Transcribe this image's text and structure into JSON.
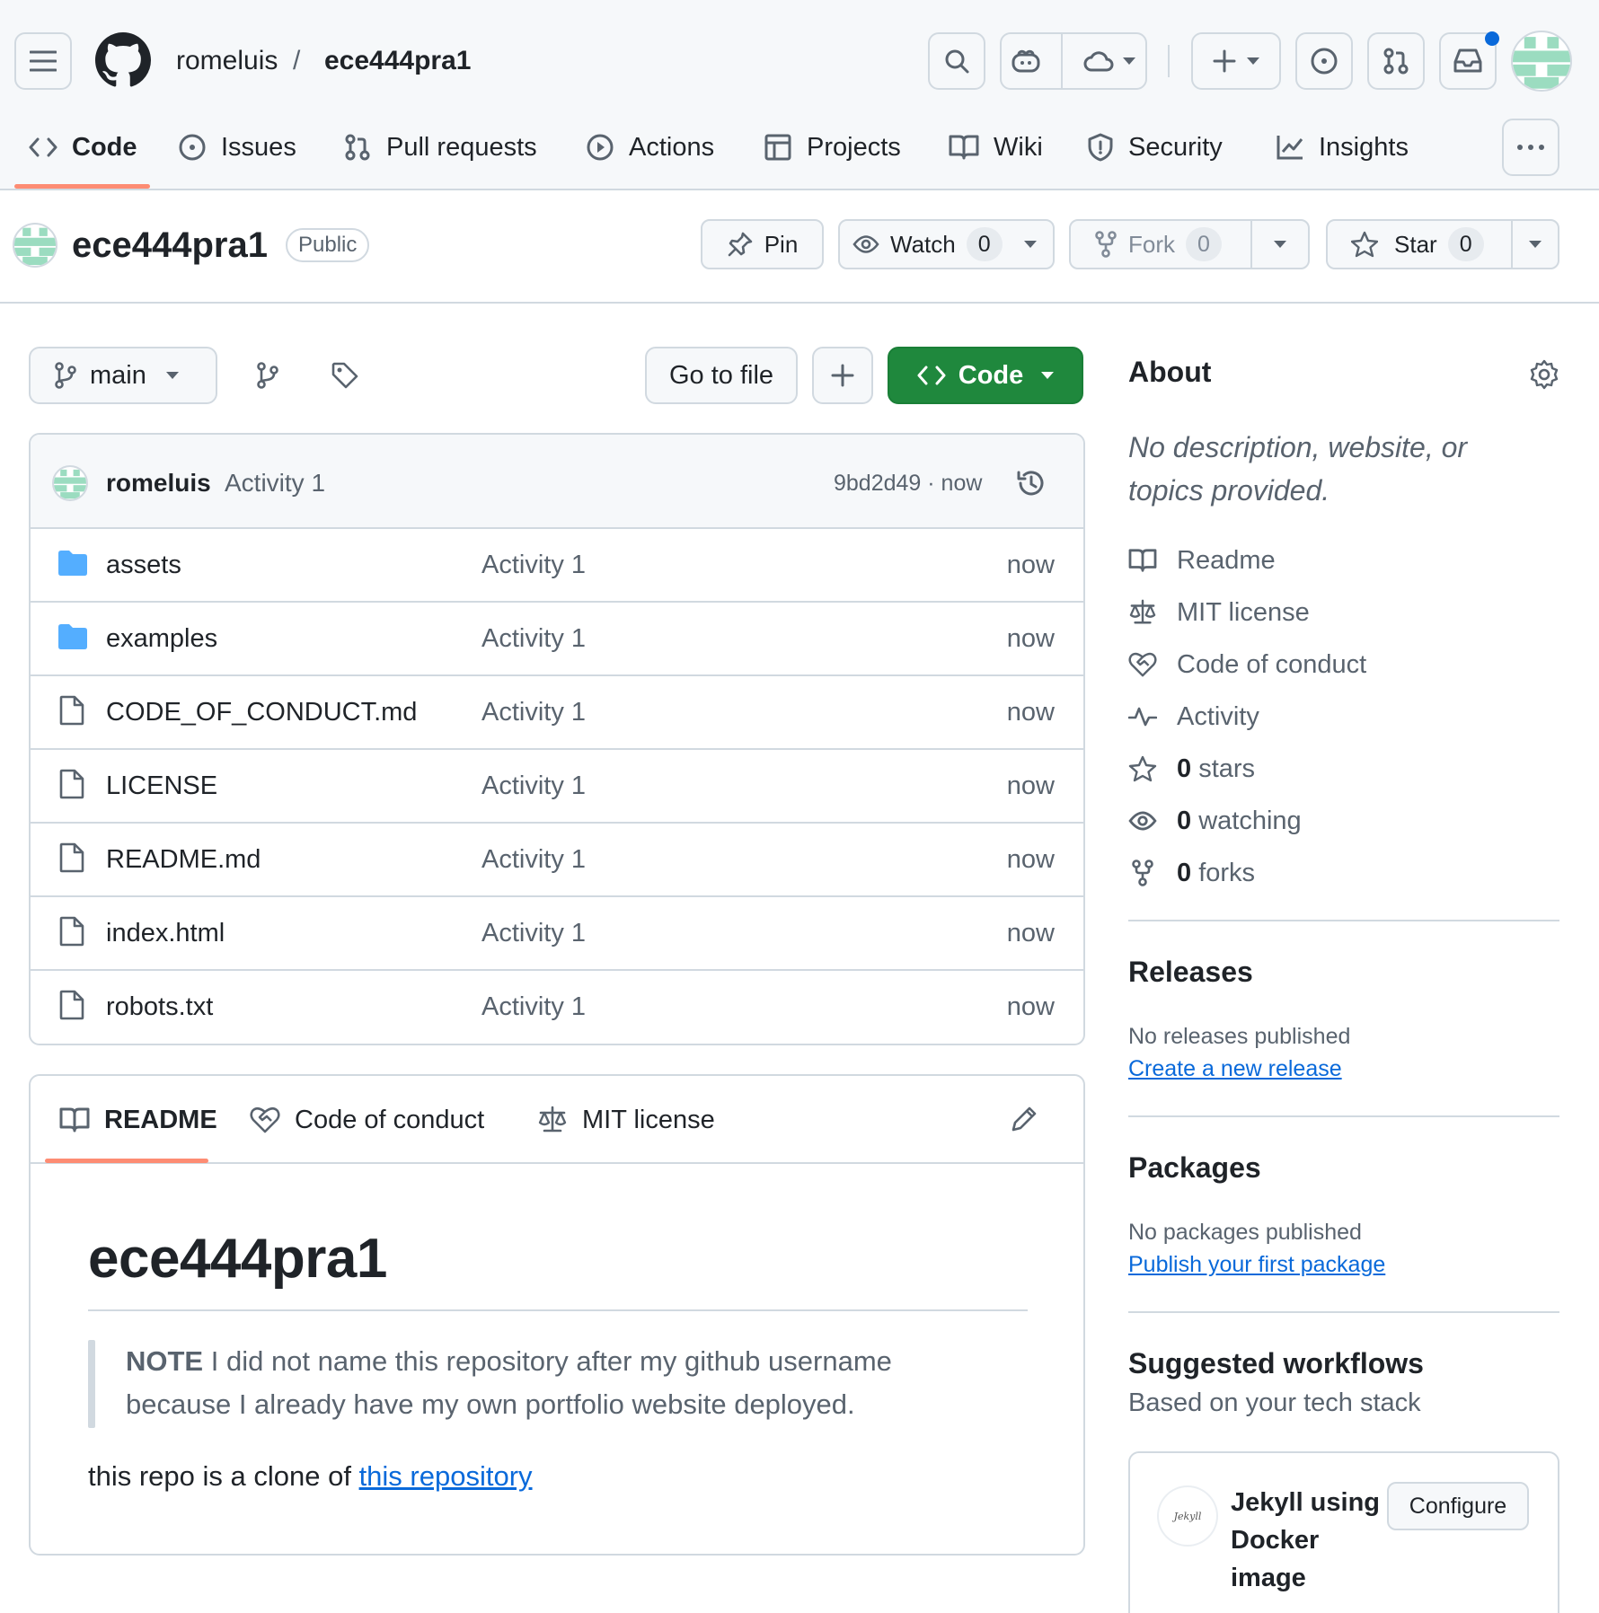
{
  "header": {
    "owner": "romeluis",
    "separator": "/",
    "repo": "ece444pra1"
  },
  "nav_tabs": [
    {
      "label": "Code",
      "icon": "code-icon",
      "active": true
    },
    {
      "label": "Issues",
      "icon": "issue-icon"
    },
    {
      "label": "Pull requests",
      "icon": "pull-request-icon"
    },
    {
      "label": "Actions",
      "icon": "play-icon"
    },
    {
      "label": "Projects",
      "icon": "table-icon"
    },
    {
      "label": "Wiki",
      "icon": "book-icon"
    },
    {
      "label": "Security",
      "icon": "shield-icon"
    },
    {
      "label": "Insights",
      "icon": "graph-icon"
    }
  ],
  "repo_header": {
    "name": "ece444pra1",
    "visibility": "Public",
    "pin_label": "Pin",
    "watch_label": "Watch",
    "watch_count": "0",
    "fork_label": "Fork",
    "fork_count": "0",
    "star_label": "Star",
    "star_count": "0"
  },
  "toolbar": {
    "branch": "main",
    "go_to_file": "Go to file",
    "code_button": "Code"
  },
  "latest_commit": {
    "author": "romeluis",
    "message": "Activity 1",
    "sha_time": "9bd2d49 · now"
  },
  "files": [
    {
      "name": "assets",
      "type": "folder",
      "message": "Activity 1",
      "time": "now"
    },
    {
      "name": "examples",
      "type": "folder",
      "message": "Activity 1",
      "time": "now"
    },
    {
      "name": "CODE_OF_CONDUCT.md",
      "type": "file",
      "message": "Activity 1",
      "time": "now"
    },
    {
      "name": "LICENSE",
      "type": "file",
      "message": "Activity 1",
      "time": "now"
    },
    {
      "name": "README.md",
      "type": "file",
      "message": "Activity 1",
      "time": "now"
    },
    {
      "name": "index.html",
      "type": "file",
      "message": "Activity 1",
      "time": "now"
    },
    {
      "name": "robots.txt",
      "type": "file",
      "message": "Activity 1",
      "time": "now"
    }
  ],
  "readme": {
    "tabs": [
      "README",
      "Code of conduct",
      "MIT license"
    ],
    "title": "ece444pra1",
    "note_label": "NOTE",
    "note_text_1": " I did not name this repository after my github username",
    "note_text_2": "because I already have my own portfolio website deployed.",
    "clone_text": "this repo is a clone of ",
    "clone_link": "this repository"
  },
  "about": {
    "title": "About",
    "description_1": "No description, website, or",
    "description_2": "topics provided.",
    "links": [
      {
        "label": "Readme",
        "icon": "book-icon"
      },
      {
        "label": "MIT license",
        "icon": "law-icon"
      },
      {
        "label": "Code of conduct",
        "icon": "heart-handshake-icon"
      },
      {
        "label": "Activity",
        "icon": "pulse-icon"
      }
    ],
    "stars_count": "0",
    "stars_label": " stars",
    "watching_count": "0",
    "watching_label": " watching",
    "forks_count": "0",
    "forks_label": " forks"
  },
  "releases": {
    "title": "Releases",
    "empty": "No releases published",
    "link": "Create a new release"
  },
  "packages": {
    "title": "Packages",
    "empty": "No packages published",
    "link": "Publish your first package"
  },
  "workflows": {
    "title": "Suggested workflows",
    "subtitle": "Based on your tech stack",
    "card_title_1": "Jekyll using",
    "card_title_2": "Docker",
    "card_title_3": "image",
    "logo_text": "Jekyll",
    "configure": "Configure"
  },
  "colors": {
    "accent_underline": "#fd8c73",
    "link": "#0969da",
    "code_button": "#1f883d",
    "folder": "#54aeff",
    "notification_dot": "#0969da"
  }
}
